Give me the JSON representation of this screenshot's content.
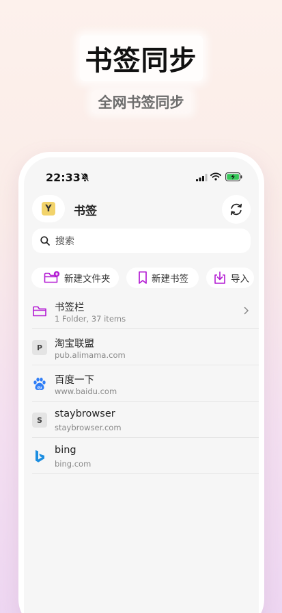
{
  "promo": {
    "headline": "书签同步",
    "subheadline": "全网书签同步"
  },
  "status_bar": {
    "time": "22:33",
    "icons": [
      "bell-slash-icon",
      "signal-icon",
      "wifi-icon",
      "battery-charging-icon"
    ]
  },
  "header": {
    "avatar_letter": "Y",
    "title": "书签",
    "sync_icon": "sync-icon"
  },
  "search": {
    "placeholder": "搜索"
  },
  "actions": {
    "new_folder": "新建文件夹",
    "new_bookmark": "新建书签",
    "import": "导入"
  },
  "bookmarks": [
    {
      "title": "书签栏",
      "subtitle": "1 Folder, 37 items",
      "icon": "folder-icon"
    },
    {
      "title": "淘宝联盟",
      "subtitle": "pub.alimama.com",
      "icon_letter": "P"
    },
    {
      "title": "百度一下",
      "subtitle": "www.baidu.com",
      "icon": "baidu-icon"
    },
    {
      "title": "staybrowser",
      "subtitle": "staybrowser.com",
      "icon_letter": "S"
    },
    {
      "title": "bing",
      "subtitle": "bing.com",
      "icon": "bing-icon"
    }
  ],
  "colors": {
    "accent": "#b31bd3",
    "avatar_bg": "#f2d36b",
    "baidu_blue": "#2f7df6",
    "bing_blue": "#1d8ee0"
  }
}
